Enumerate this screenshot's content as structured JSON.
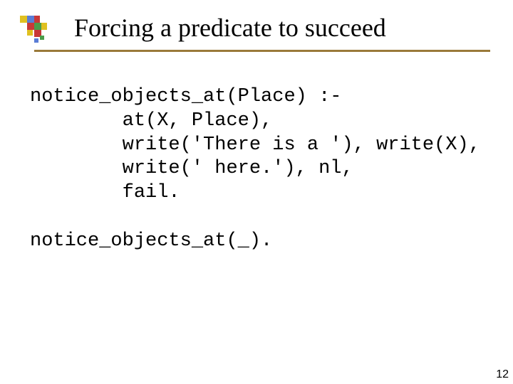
{
  "title": "Forcing a predicate to succeed",
  "code": {
    "l1": "notice_objects_at(Place) :-",
    "l2": "        at(X, Place),",
    "l3": "        write('There is a '), write(X),",
    "l4": "        write(' here.'), nl,",
    "l5": "        fail.",
    "l6": "",
    "l7": "notice_objects_at(_)."
  },
  "page_number": "12"
}
